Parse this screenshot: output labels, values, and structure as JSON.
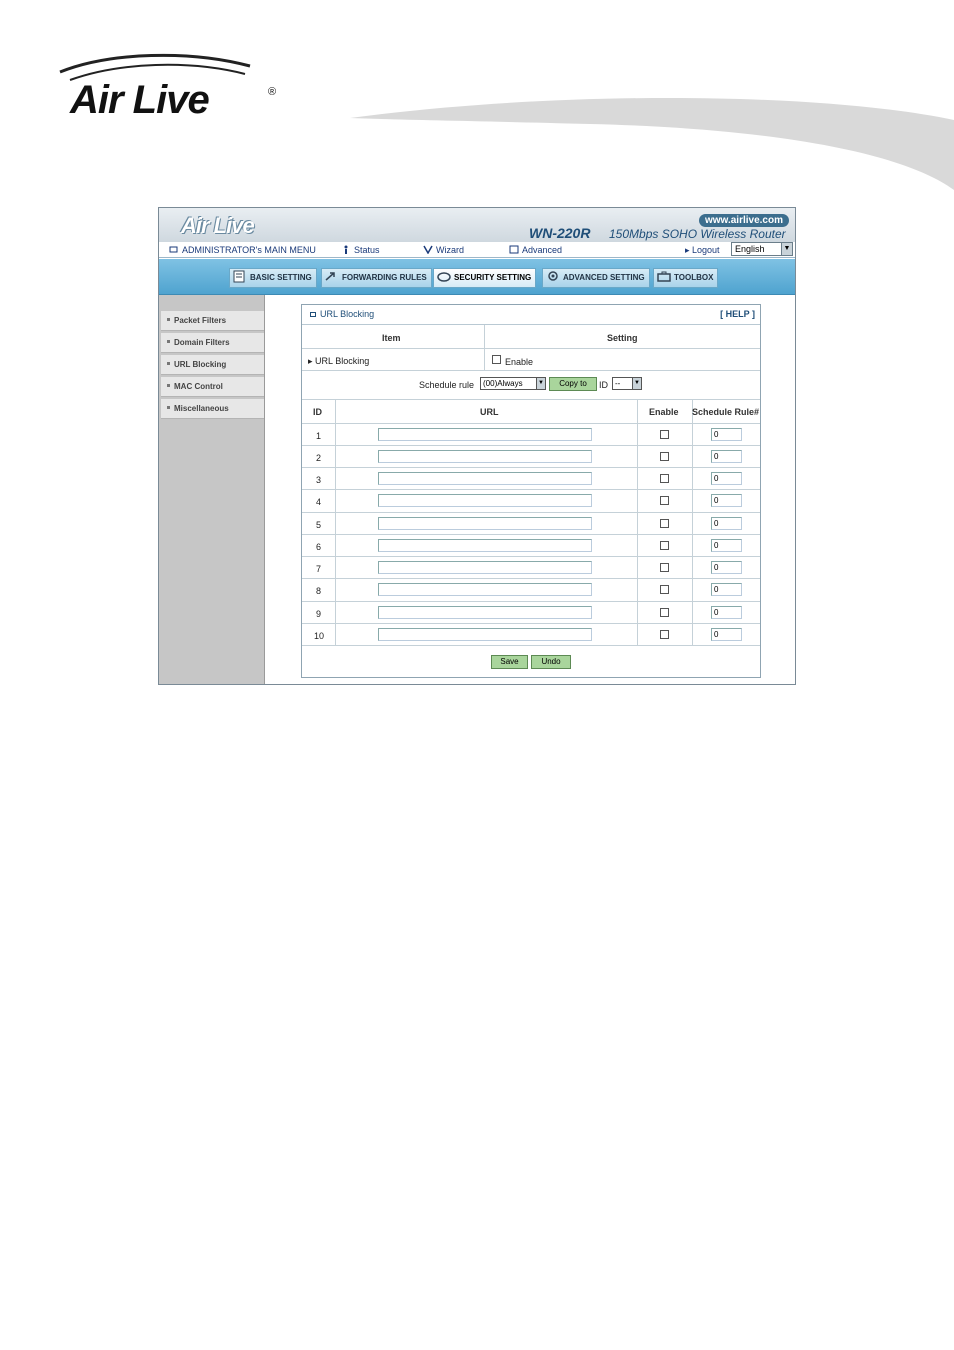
{
  "document": {
    "logo_text": "Air Live",
    "logo_mark": "®"
  },
  "app": {
    "logo": "Air Live",
    "url": "www.airlive.com",
    "model": "WN-220R",
    "subtitle": "150Mbps SOHO Wireless Router"
  },
  "main_menu": {
    "admin": "ADMINISTRATOR's MAIN MENU",
    "status": "Status",
    "wizard": "Wizard",
    "advanced": "Advanced",
    "logout": "Logout",
    "language": "English"
  },
  "tabs": [
    {
      "label": "BASIC SETTING",
      "icon": "document-icon"
    },
    {
      "label": "FORWARDING RULES",
      "icon": "arrow-icon"
    },
    {
      "label": "SECURITY SETTING",
      "icon": "lock-icon"
    },
    {
      "label": "ADVANCED SETTING",
      "icon": "gear-icon"
    },
    {
      "label": "TOOLBOX",
      "icon": "toolbox-icon"
    }
  ],
  "sidebar": {
    "items": [
      {
        "label": "Packet Filters"
      },
      {
        "label": "Domain Filters"
      },
      {
        "label": "URL Blocking"
      },
      {
        "label": "MAC Control"
      },
      {
        "label": "Miscellaneous"
      }
    ]
  },
  "panel": {
    "title": "URL Blocking",
    "help": "[ HELP ]",
    "header_item": "Item",
    "header_setting": "Setting",
    "row_label": "URL Blocking",
    "enable_label": "Enable",
    "schedule_label": "Schedule rule",
    "schedule_value": "(00)Always",
    "copy_to": "Copy to",
    "id_label": "ID",
    "id_value": "--",
    "col_id": "ID",
    "col_url": "URL",
    "col_enable": "Enable",
    "col_rule": "Schedule Rule#",
    "rows": [
      {
        "id": "1",
        "rule": "0"
      },
      {
        "id": "2",
        "rule": "0"
      },
      {
        "id": "3",
        "rule": "0"
      },
      {
        "id": "4",
        "rule": "0"
      },
      {
        "id": "5",
        "rule": "0"
      },
      {
        "id": "6",
        "rule": "0"
      },
      {
        "id": "7",
        "rule": "0"
      },
      {
        "id": "8",
        "rule": "0"
      },
      {
        "id": "9",
        "rule": "0"
      },
      {
        "id": "10",
        "rule": "0"
      }
    ],
    "save": "Save",
    "undo": "Undo"
  }
}
